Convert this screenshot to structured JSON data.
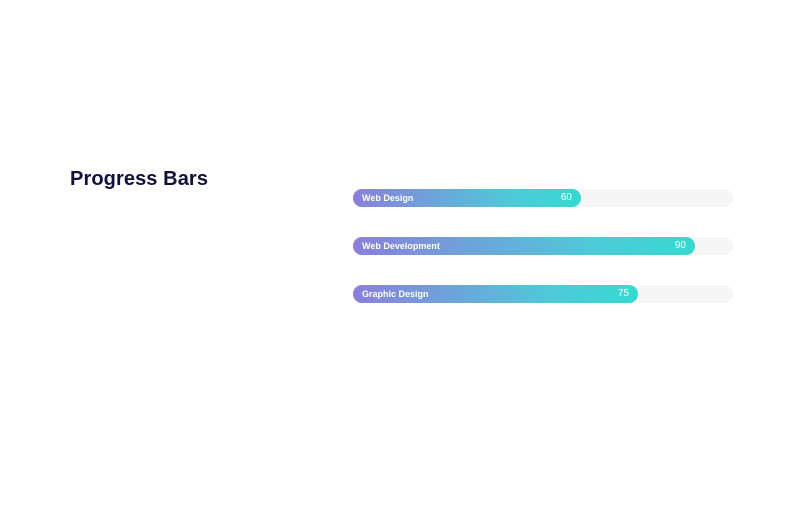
{
  "title": "Progress Bars",
  "colors": {
    "gradient_start": "#8a7fdc",
    "gradient_end": "#36d9d1",
    "track": "#f5f5f6",
    "title": "#11103a"
  },
  "bars": [
    {
      "label": "Web Design",
      "value": 60,
      "display": "60"
    },
    {
      "label": "Web Development",
      "value": 90,
      "display": "90"
    },
    {
      "label": "Graphic Design",
      "value": 75,
      "display": "75"
    }
  ]
}
